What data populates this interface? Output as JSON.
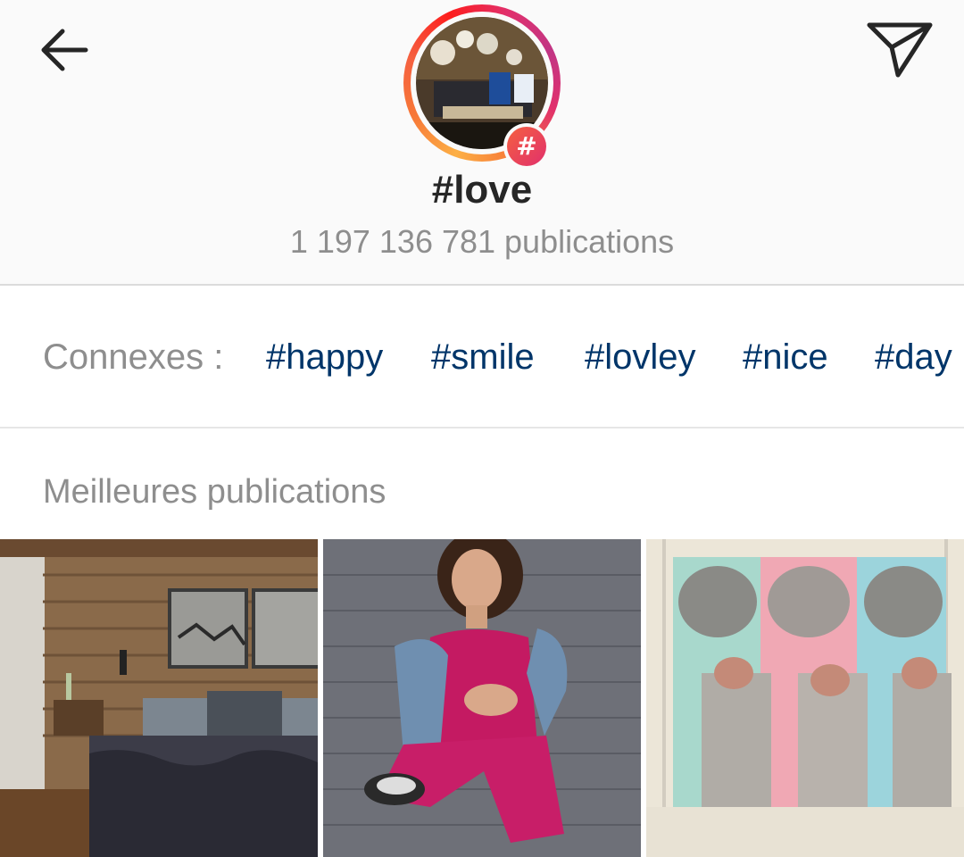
{
  "header": {
    "hashtag": "#love",
    "post_count": "1 197 136 781 publications",
    "badge_symbol": "#"
  },
  "related": {
    "label": "Connexes :",
    "tags": [
      "#happy",
      "#smile",
      "#lovley",
      "#nice",
      "#day"
    ]
  },
  "sections": {
    "top_posts": "Meilleures publications"
  },
  "icons": {
    "back": "back-arrow-icon",
    "send": "paper-plane-icon",
    "hashtag": "hashtag-icon"
  },
  "colors": {
    "tag_link": "#003569",
    "muted_text": "#8e8e8e",
    "title_text": "#262626",
    "header_bg": "#fafafa"
  },
  "posts": [
    {
      "subject": "rustic-bedroom"
    },
    {
      "subject": "woman-pink-dress"
    },
    {
      "subject": "newborn-triplets"
    }
  ]
}
